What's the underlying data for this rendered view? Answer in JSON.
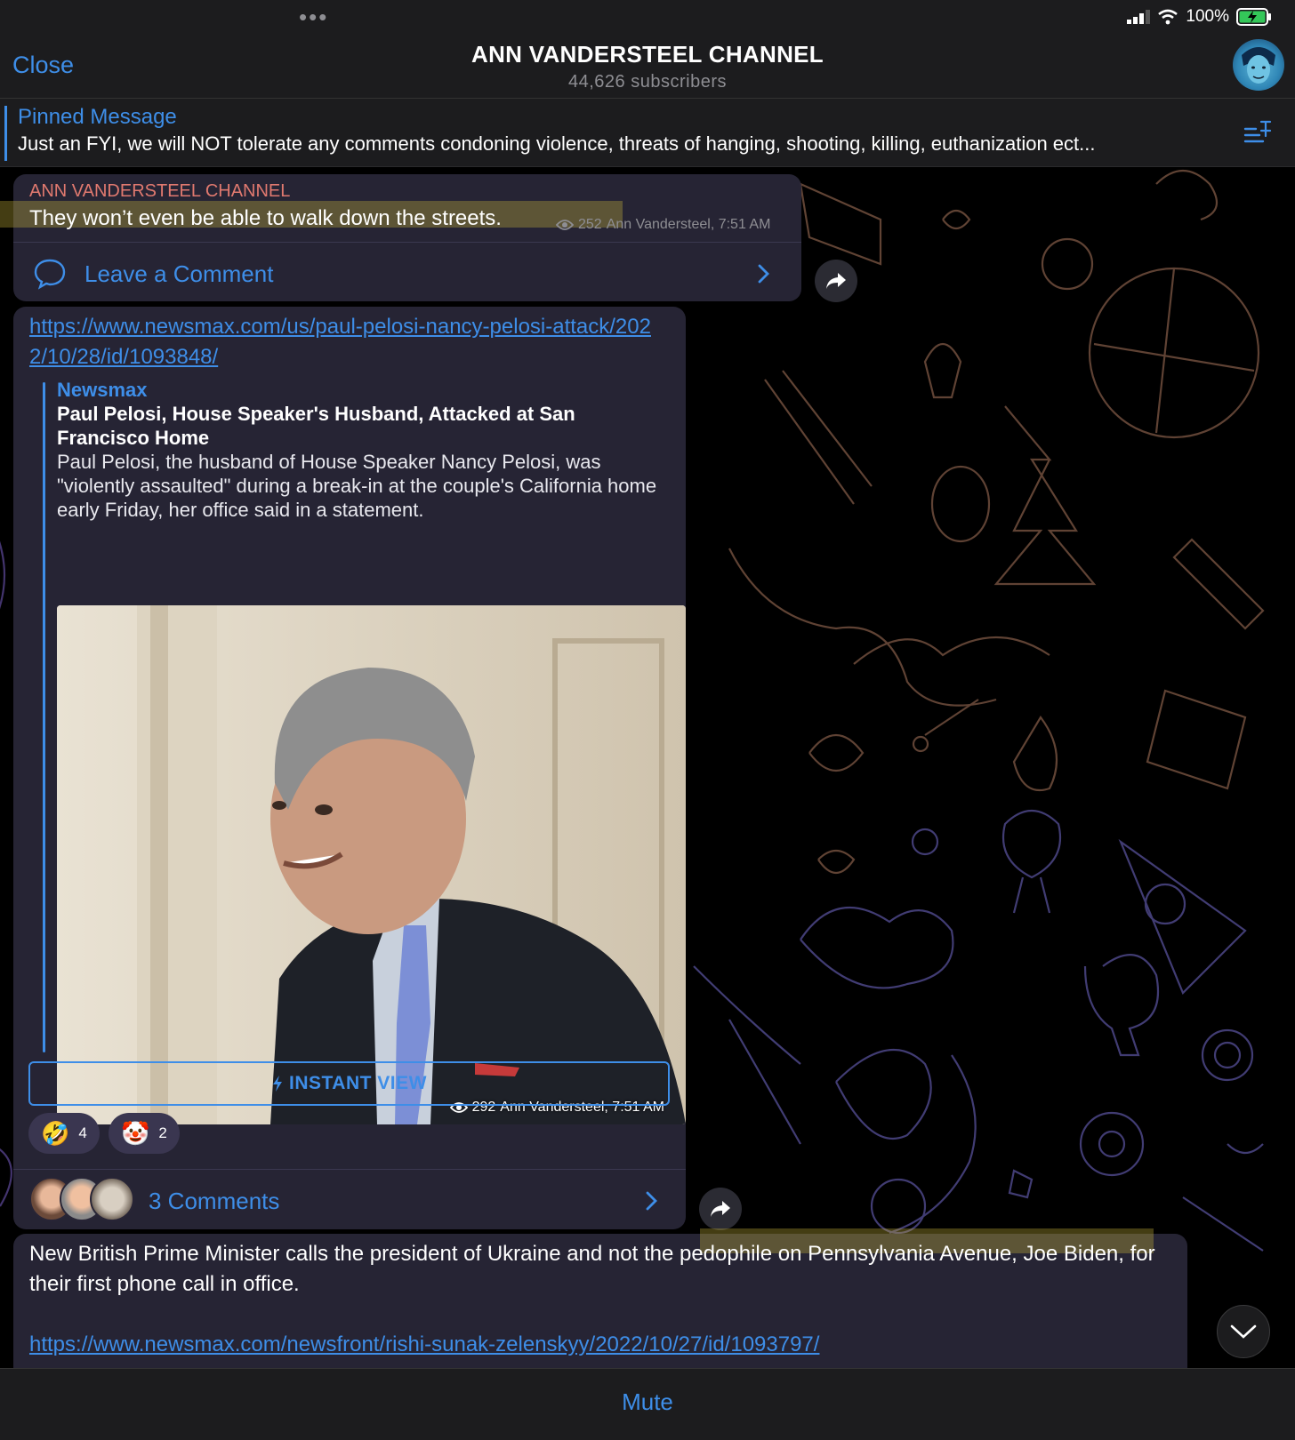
{
  "status": {
    "battery": "100%"
  },
  "header": {
    "close_label": "Close",
    "title": "ANN VANDERSTEEL CHANNEL",
    "subtitle": "44,626 subscribers"
  },
  "pinned": {
    "title": "Pinned Message",
    "text": "Just an FYI, we will NOT tolerate any comments condoning violence, threats of hanging, shooting, killing, euthanization ect..."
  },
  "message1": {
    "author": "ANN VANDERSTEEL CHANNEL",
    "text": "They won’t even be able to walk down the streets.",
    "views": "252",
    "meta": "Ann Vandersteel, 7:51 AM",
    "comment_label": "Leave a Comment"
  },
  "message2": {
    "link": "https://www.newsmax.com/us/paul-pelosi-nancy-pelosi-attack/2022/10/28/id/1093848/",
    "site": "Newsmax",
    "title": "Paul Pelosi, House Speaker's Husband, Attacked at San Francisco Home",
    "description": "Paul Pelosi, the husband of House Speaker Nancy Pelosi, was \"violently assaulted\" during a break-in at the couple's California home early Friday, her office said in a statement.",
    "views": "292",
    "meta": "Ann Vandersteel, 7:51 AM",
    "instant_view_label": "INSTANT VIEW",
    "reactions": [
      {
        "emoji": "🤣",
        "count": "4"
      },
      {
        "emoji": "🤡",
        "count": "2"
      }
    ],
    "comments_label": "3 Comments"
  },
  "message3": {
    "text": "New British Prime Minister calls the president of Ukraine and not the pedophile on Pennsylvania Avenue, Joe Biden, for their first phone call in office.",
    "link": "https://www.newsmax.com/newsfront/rishi-sunak-zelenskyy/2022/10/27/id/1093797/"
  },
  "footer": {
    "mute_label": "Mute"
  },
  "colors": {
    "accent": "#3e8ee8",
    "author": "#e0796f",
    "bubble": "#282536"
  }
}
